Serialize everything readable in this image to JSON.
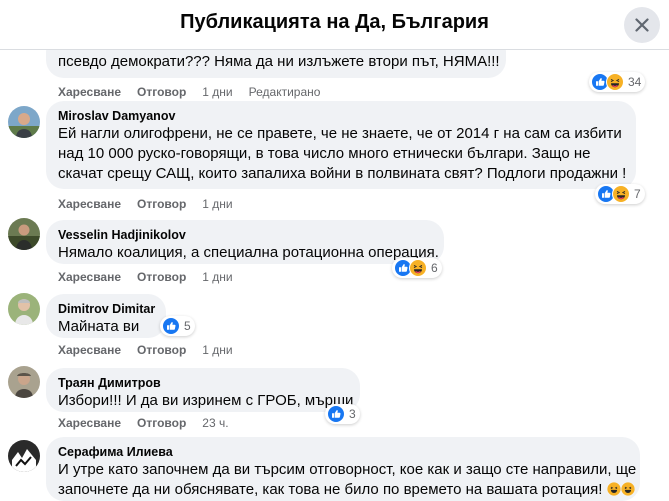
{
  "header": {
    "title": "Публикацията на Да, България"
  },
  "actions": {
    "like": "Харесване",
    "reply": "Отговор",
    "edited": "Редактирано"
  },
  "comments": [
    {
      "author": "",
      "lines": [
        "псевдо демократи??? Няма да ни излъжете втори път, НЯМА!!!"
      ],
      "time": "1 дни",
      "edited": true,
      "reactions": {
        "types": [
          "like",
          "haha"
        ],
        "count": "34"
      }
    },
    {
      "author": "Miroslav Damyanov",
      "lines": [
        "Ей нагли олигофрени, не се правете, че не знаете, че от 2014 г на сам са избити",
        "над 10 000 руско-говорящи, в това число много етнически българи. Защо не",
        "скачат срещу САЩ, които запалиха войни в полвината свят? Подлоги продажни !"
      ],
      "time": "1 дни",
      "reactions": {
        "types": [
          "like",
          "haha"
        ],
        "count": "7"
      }
    },
    {
      "author": "Vesselin Hadjinikolov",
      "lines": [
        "Нямало коалиция, а специална ротационна операция."
      ],
      "time": "1 дни",
      "reactions": {
        "types": [
          "like",
          "haha"
        ],
        "count": "6"
      }
    },
    {
      "author": "Dimitrov Dimitar",
      "lines": [
        "Майната ви"
      ],
      "time": "1 дни",
      "reactions": {
        "types": [
          "like"
        ],
        "count": "5"
      }
    },
    {
      "author": "Траян Димитров",
      "lines": [
        "Избори!!! И да ви изринем с ГРОБ, мърши"
      ],
      "time": "23 ч.",
      "reactions": {
        "types": [
          "like"
        ],
        "count": "3"
      }
    },
    {
      "author": "Серафима Илиева",
      "lines": [
        "И утре като започнем да ви търсим отговорност, кое как и защо сте направили, ще",
        "започнете да ни обяснявате, как това не било по времето на вашата ротация!"
      ],
      "time": "",
      "reactions": {
        "types": [
          "haha",
          "haha"
        ],
        "count": ""
      }
    }
  ],
  "icons": {
    "close": "close-icon",
    "like": "like-reaction-icon",
    "haha": "haha-reaction-icon"
  },
  "colors": {
    "like_blue": "#1877f2",
    "haha_yellow": "#f7b125",
    "bubble_bg": "#f0f2f5",
    "meta_text": "#65676b"
  }
}
